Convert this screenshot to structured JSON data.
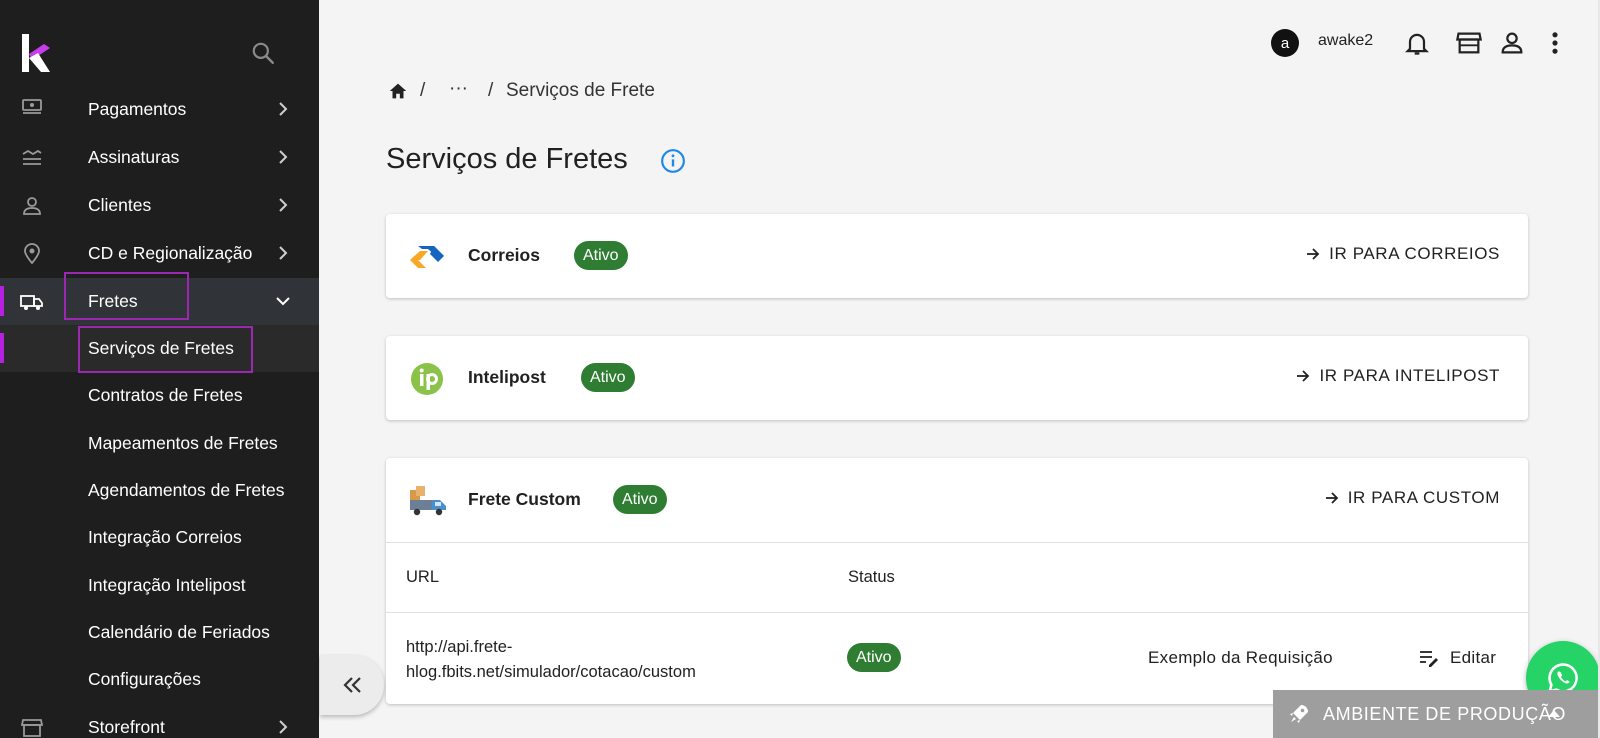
{
  "sidebar": {
    "items": [
      {
        "label": "Pagamentos",
        "icon": "money-icon"
      },
      {
        "label": "Assinaturas",
        "icon": "layers-icon"
      },
      {
        "label": "Clientes",
        "icon": "person-icon"
      },
      {
        "label": "CD e Regionalização",
        "icon": "location-icon"
      },
      {
        "label": "Fretes",
        "icon": "truck-icon"
      },
      {
        "label": "Storefront",
        "icon": "store-icon"
      }
    ],
    "subitems": [
      {
        "label": "Serviços de Fretes"
      },
      {
        "label": "Contratos de Fretes"
      },
      {
        "label": "Mapeamentos de Fretes"
      },
      {
        "label": "Agendamentos de Fretes"
      },
      {
        "label": "Integração Correios"
      },
      {
        "label": "Integração Intelipost"
      },
      {
        "label": "Calendário de Feriados"
      },
      {
        "label": "Configurações"
      }
    ],
    "accent": "#b620e0",
    "highlight_color": "#9c27b0"
  },
  "topbar": {
    "avatar_letter": "a",
    "username": "awake2"
  },
  "breadcrumb": {
    "separator": "/",
    "ellipsis": "···",
    "current": "Serviços de Frete"
  },
  "page": {
    "title": "Serviços de Fretes"
  },
  "providers": [
    {
      "name": "Correios",
      "status": "Ativo",
      "link": "IR PARA CORREIOS"
    },
    {
      "name": "Intelipost",
      "status": "Ativo",
      "link": "IR PARA INTELIPOST"
    },
    {
      "name": "Frete Custom",
      "status": "Ativo",
      "link": "IR PARA CUSTOM"
    }
  ],
  "custom_table": {
    "headers": {
      "url": "URL",
      "status": "Status"
    },
    "row": {
      "url_line1": "http://api.frete-",
      "url_line2": "hlog.fbits.net/simulador/cotacao/custom",
      "status": "Ativo",
      "example_label": "Exemplo da Requisição",
      "edit_label": "Editar"
    }
  },
  "environment": {
    "label": "AMBIENTE DE PRODUÇÃO"
  },
  "colors": {
    "badge_green": "#2e7d32",
    "info_blue": "#1e88e5",
    "whatsapp_green": "#25d366"
  }
}
